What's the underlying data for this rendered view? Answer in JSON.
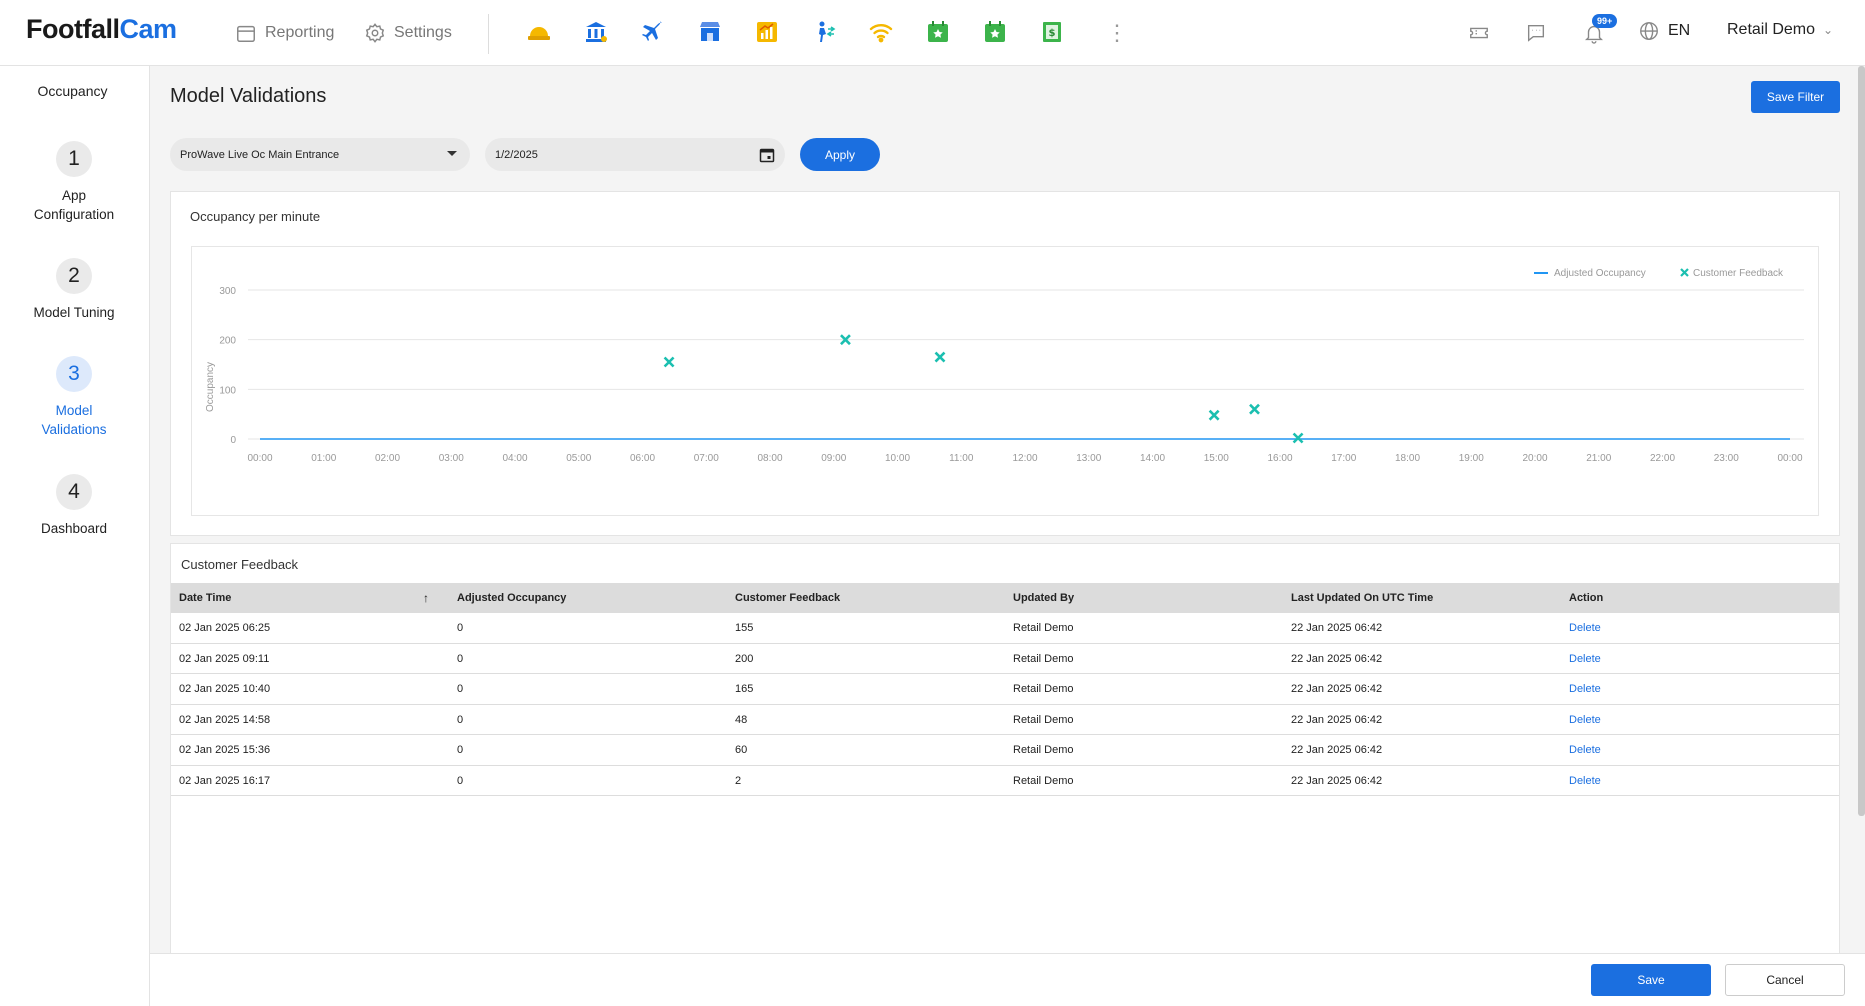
{
  "header": {
    "logo_part1": "Footfall",
    "logo_part2": "Cam",
    "reporting_label": "Reporting",
    "settings_label": "Settings",
    "notifications_badge": "99+",
    "language": "EN",
    "user_name": "Retail Demo",
    "app_icons": [
      "hardhat-icon",
      "bank-icon",
      "airplane-icon",
      "store-icon",
      "growth-chart-icon",
      "person-transfer-icon",
      "wifi-icon",
      "calendar-star-icon",
      "calendar-star-icon",
      "currency-note-icon"
    ]
  },
  "sidebar": {
    "title": "Occupancy",
    "steps": [
      {
        "num": "1",
        "line1": "App",
        "line2": "Configuration"
      },
      {
        "num": "2",
        "line1": "Model Tuning",
        "line2": ""
      },
      {
        "num": "3",
        "line1": "Model",
        "line2": "Validations"
      },
      {
        "num": "4",
        "line1": "Dashboard",
        "line2": ""
      }
    ]
  },
  "main": {
    "title": "Model Validations",
    "save_filter": "Save Filter",
    "site_select": "ProWave Live Oc Main Entrance",
    "date_value": "1/2/2025",
    "apply": "Apply"
  },
  "chart_data": {
    "type": "scatter",
    "title": "Occupancy per minute",
    "ylabel": "Occupancy",
    "ylim": [
      0,
      300
    ],
    "y_ticks": [
      "300",
      "200",
      "100",
      "0"
    ],
    "x_ticks": [
      "00:00",
      "01:00",
      "02:00",
      "03:00",
      "04:00",
      "05:00",
      "06:00",
      "07:00",
      "08:00",
      "09:00",
      "10:00",
      "11:00",
      "12:00",
      "13:00",
      "14:00",
      "15:00",
      "16:00",
      "17:00",
      "18:00",
      "19:00",
      "20:00",
      "21:00",
      "22:00",
      "23:00",
      "00:00"
    ],
    "series": [
      {
        "name": "Adjusted Occupancy",
        "kind": "line",
        "color": "#2196f3",
        "x": [
          "00:00",
          "24:00"
        ],
        "y": [
          0,
          0
        ]
      },
      {
        "name": "Customer Feedback",
        "kind": "scatter",
        "color": "#1bbfb0",
        "x": [
          "06:25",
          "09:11",
          "10:40",
          "14:58",
          "15:36",
          "16:17"
        ],
        "y": [
          155,
          200,
          165,
          48,
          60,
          2
        ]
      }
    ]
  },
  "table": {
    "title": "Customer Feedback",
    "sort_indicator": "↑",
    "columns": [
      "Date Time",
      "Adjusted Occupancy",
      "Customer Feedback",
      "Updated By",
      "Last Updated On UTC Time",
      "Action"
    ],
    "rows": [
      [
        "02 Jan 2025 06:25",
        "0",
        "155",
        "Retail Demo",
        "22 Jan 2025 06:42",
        "Delete"
      ],
      [
        "02 Jan 2025 09:11",
        "0",
        "200",
        "Retail Demo",
        "22 Jan 2025 06:42",
        "Delete"
      ],
      [
        "02 Jan 2025 10:40",
        "0",
        "165",
        "Retail Demo",
        "22 Jan 2025 06:42",
        "Delete"
      ],
      [
        "02 Jan 2025 14:58",
        "0",
        "48",
        "Retail Demo",
        "22 Jan 2025 06:42",
        "Delete"
      ],
      [
        "02 Jan 2025 15:36",
        "0",
        "60",
        "Retail Demo",
        "22 Jan 2025 06:42",
        "Delete"
      ],
      [
        "02 Jan 2025 16:17",
        "0",
        "2",
        "Retail Demo",
        "22 Jan 2025 06:42",
        "Delete"
      ]
    ]
  },
  "footer": {
    "save": "Save",
    "cancel": "Cancel"
  }
}
